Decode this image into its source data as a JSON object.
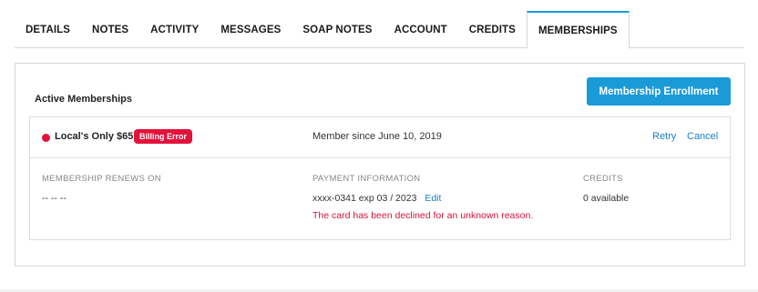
{
  "tabs": [
    {
      "label": "DETAILS"
    },
    {
      "label": "NOTES"
    },
    {
      "label": "ACTIVITY"
    },
    {
      "label": "MESSAGES"
    },
    {
      "label": "SOAP NOTES"
    },
    {
      "label": "ACCOUNT"
    },
    {
      "label": "CREDITS"
    },
    {
      "label": "MEMBERSHIPS",
      "active": true
    }
  ],
  "panel": {
    "title": "Active Memberships",
    "enroll_button": "Membership Enrollment"
  },
  "membership": {
    "status_dot_color": "#e2123b",
    "plan_name": "Local's Only $65",
    "badge": "Billing Error",
    "member_since": "Member since June 10, 2019",
    "retry_label": "Retry",
    "cancel_label": "Cancel",
    "renews_label": "MEMBERSHIP RENEWS ON",
    "renews_value": "-- -- --",
    "payment_label": "PAYMENT INFORMATION",
    "payment_value": "xxxx-0341 exp 03 / 2023",
    "edit_label": "Edit",
    "payment_error": "The card has been declined for an unknown reason.",
    "credits_label": "CREDITS",
    "credits_value": "0 available"
  },
  "colors": {
    "accent": "#1a9bd7",
    "link": "#1a7fc1",
    "error": "#e2123b"
  }
}
